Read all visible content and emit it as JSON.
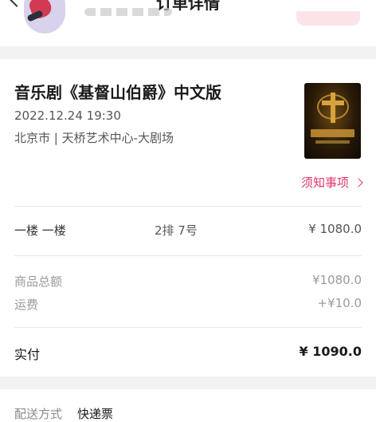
{
  "header": {
    "title": "订单详情"
  },
  "show": {
    "title": "音乐剧《基督山伯爵》中文版",
    "datetime": "2022.12.24 19:30",
    "venue": "北京市 | 天桥艺术中心-大剧场",
    "notice_label": "须知事项"
  },
  "ticket": {
    "zone": "一楼 一楼",
    "seat": "2排 7号",
    "price": "¥ 1080.0"
  },
  "summary": {
    "goods_total_label": "商品总额",
    "goods_total_value": "¥1080.0",
    "shipping_label": "运费",
    "shipping_value": "+¥10.0",
    "paid_label": "实付",
    "paid_value": "¥ 1090.0"
  },
  "delivery": {
    "label": "配送方式",
    "value": "快递票"
  },
  "colors": {
    "accent": "#e3366a",
    "background": "#f2f2f2"
  }
}
